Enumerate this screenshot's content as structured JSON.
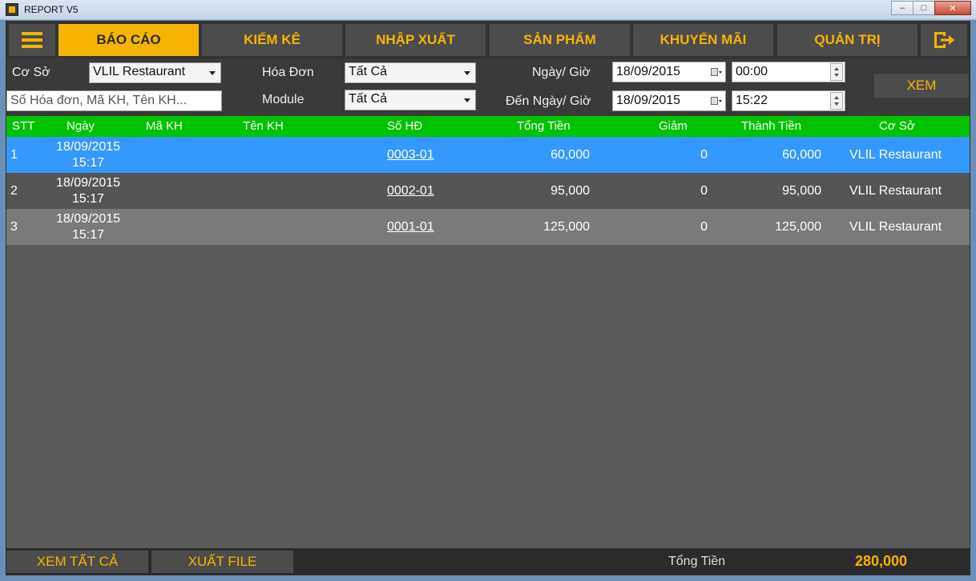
{
  "window": {
    "title": "REPORT V5",
    "min": "–",
    "max": "□",
    "close": "✕"
  },
  "nav": {
    "items": [
      "BÁO CÁO",
      "KIỂM KÊ",
      "NHẬP XUẤT",
      "SẢN PHẨM",
      "KHUYẾN MÃI",
      "QUẢN TRỊ"
    ],
    "active": "BÁO CÁO"
  },
  "filters": {
    "co_so_label": "Cơ Sở",
    "co_so_value": "VLIL Restaurant",
    "search_placeholder": "Số Hóa đơn, Mã KH, Tên KH...",
    "hoa_don_label": "Hóa Đơn",
    "hoa_don_value": "Tất Cả",
    "module_label": "Module",
    "module_value": "Tất Cả",
    "from_label": "Ngày/ Giờ",
    "from_date": "18/09/2015",
    "from_time": "00:00",
    "to_label": "Đến Ngày/ Giờ",
    "to_date": "18/09/2015",
    "to_time": "15:22",
    "view_button": "XEM"
  },
  "table": {
    "headers": [
      "STT",
      "Ngày",
      "Mã KH",
      "Tên KH",
      "Số HĐ",
      "Tổng Tiền",
      "Giảm",
      "Thành Tiền",
      "Cơ Sở"
    ],
    "rows": [
      {
        "stt": "1",
        "date": "18/09/2015",
        "time": "15:17",
        "ma_kh": "",
        "ten_kh": "",
        "so_hd": "0003-01",
        "tong_tien": "60,000",
        "giam": "0",
        "thanh_tien": "60,000",
        "co_so": "VLIL Restaurant"
      },
      {
        "stt": "2",
        "date": "18/09/2015",
        "time": "15:17",
        "ma_kh": "",
        "ten_kh": "",
        "so_hd": "0002-01",
        "tong_tien": "95,000",
        "giam": "0",
        "thanh_tien": "95,000",
        "co_so": "VLIL Restaurant"
      },
      {
        "stt": "3",
        "date": "18/09/2015",
        "time": "15:17",
        "ma_kh": "",
        "ten_kh": "",
        "so_hd": "0001-01",
        "tong_tien": "125,000",
        "giam": "0",
        "thanh_tien": "125,000",
        "co_so": "VLIL Restaurant"
      }
    ]
  },
  "footer": {
    "view_all": "XEM TẤT CẢ",
    "export": "XUẤT FILE",
    "total_label": "Tổng Tiền",
    "total_value": "280,000"
  },
  "colors": {
    "accent": "#f5b400",
    "header_green": "#00c300",
    "row_selected": "#3399ff",
    "row_dark": "#555555",
    "row_light": "#7a7a7a"
  }
}
